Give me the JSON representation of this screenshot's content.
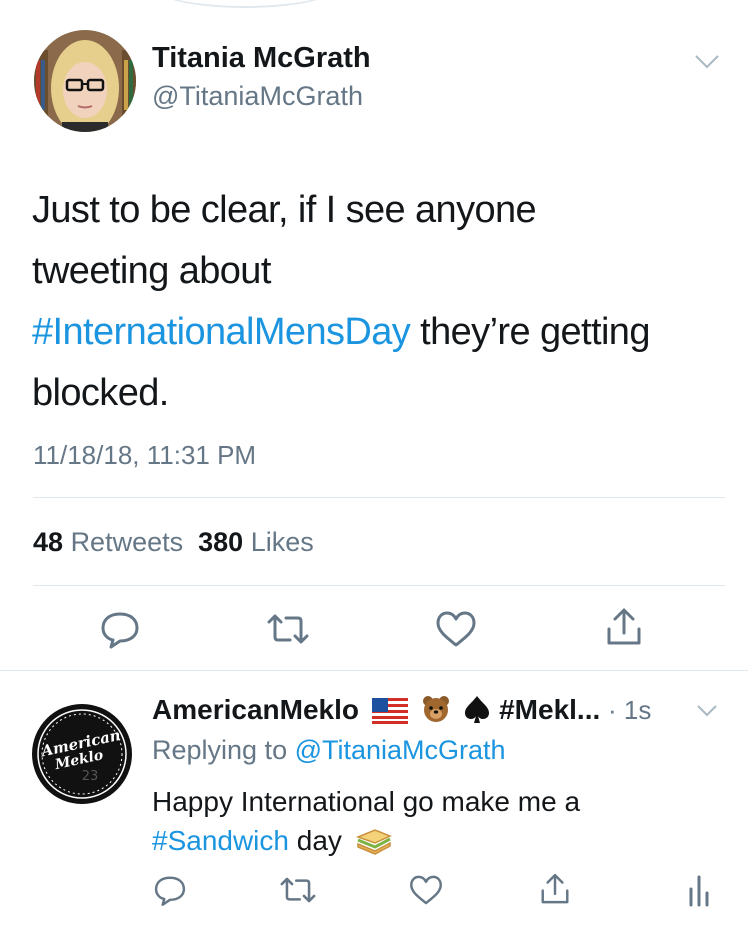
{
  "main_tweet": {
    "author_name": "Titania McGrath",
    "author_handle": "@TitaniaMcGrath",
    "text_line1": "Just to be clear, if I see anyone",
    "text_line2": "tweeting about",
    "text_hashtag": "#InternationalMensDay",
    "text_line3_rest": " they’re getting",
    "text_line4": "blocked.",
    "timestamp": "11/18/18, 11:31 PM",
    "retweets_count": "48",
    "retweets_label": "Retweets",
    "likes_count": "380",
    "likes_label": "Likes"
  },
  "reply_tweet": {
    "author_name": "AmericanMeklo",
    "name_suffix": "#Mekl...",
    "time": "· 1s",
    "replying_prefix": "Replying to ",
    "replying_to": "@TitaniaMcGrath",
    "text_line1": "Happy International go make me a",
    "text_hashtag": "#Sandwich",
    "text_rest": " day",
    "avatar_logo_line1": "American",
    "avatar_logo_line2": "Meklo",
    "avatar_logo_number": "23"
  },
  "icons": {
    "reply": "speech-bubble-icon",
    "retweet": "retweet-arrows-icon",
    "like": "heart-icon",
    "share": "share-upload-icon",
    "analytics": "bar-chart-icon",
    "caret": "chevron-down-icon"
  },
  "colors": {
    "link": "#1b95e0",
    "secondary_text": "#657786",
    "primary_text": "#14171a",
    "divider": "#e1e8ed"
  }
}
